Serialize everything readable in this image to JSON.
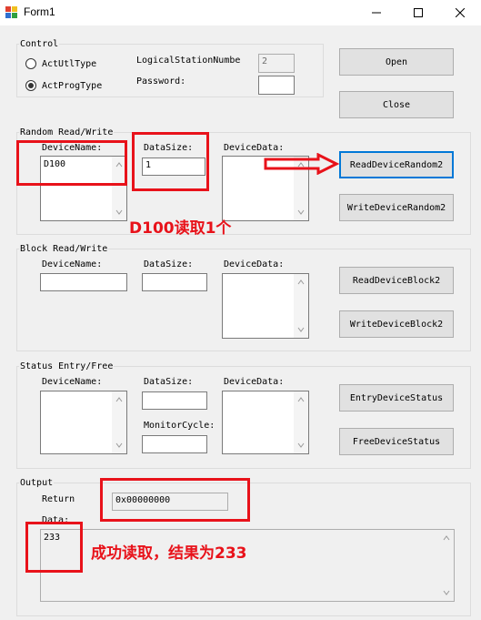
{
  "window": {
    "title": "Form1"
  },
  "control": {
    "legend": "Control",
    "radio_utl": "ActUtlType",
    "radio_prog": "ActProgType",
    "logical_station_label": "LogicalStationNumbe",
    "logical_station_value": "2",
    "password_label": "Password:",
    "password_value": "",
    "open_label": "Open",
    "close_label": "Close"
  },
  "random": {
    "legend": "Random Read/Write",
    "device_name_label": "DeviceName:",
    "device_name_value": "D100",
    "data_size_label": "DataSize:",
    "data_size_value": "1",
    "device_data_label": "DeviceData:",
    "read_label": "ReadDeviceRandom2",
    "write_label": "WriteDeviceRandom2"
  },
  "block": {
    "legend": "Block Read/Write",
    "device_name_label": "DeviceName:",
    "data_size_label": "DataSize:",
    "device_data_label": "DeviceData:",
    "read_label": "ReadDeviceBlock2",
    "write_label": "WriteDeviceBlock2"
  },
  "status": {
    "legend": "Status Entry/Free",
    "device_name_label": "DeviceName:",
    "data_size_label": "DataSize:",
    "monitor_cycle_label": "MonitorCycle:",
    "device_data_label": "DeviceData:",
    "entry_label": "EntryDeviceStatus",
    "free_label": "FreeDeviceStatus"
  },
  "output": {
    "legend": "Output",
    "return_label": "Return",
    "return_value": "0x00000000",
    "data_label": "Data:",
    "data_value": "233"
  },
  "annotations": {
    "read_note": "D100读取1个",
    "result_note": "成功读取，结果为233",
    "color": "#e8121a"
  }
}
